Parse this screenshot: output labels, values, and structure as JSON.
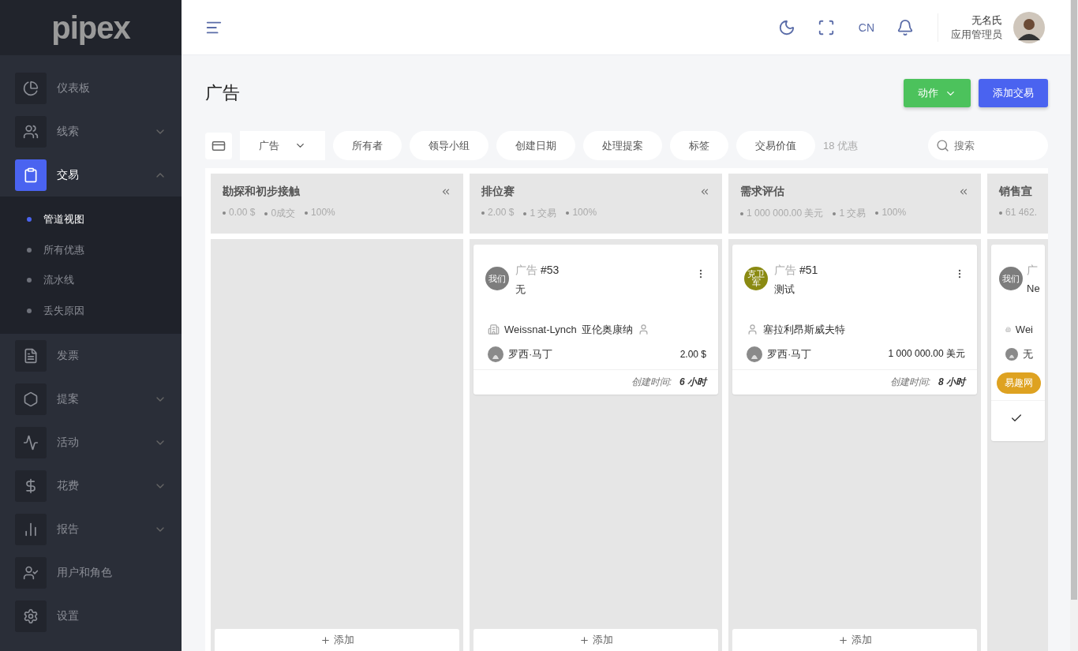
{
  "sidebar": {
    "logo": "pipex",
    "items": [
      {
        "label": "仪表板",
        "selected": false
      },
      {
        "label": "线索",
        "expanded": false,
        "selected": false
      },
      {
        "label": "交易",
        "expanded": true,
        "selected": true,
        "children": [
          {
            "label": "管道视图",
            "selected": true
          },
          {
            "label": "所有优惠",
            "selected": false
          },
          {
            "label": "流水线",
            "selected": false
          },
          {
            "label": "丢失原因",
            "selected": false
          }
        ]
      },
      {
        "label": "发票",
        "selected": false
      },
      {
        "label": "提案",
        "expanded": false,
        "selected": false
      },
      {
        "label": "活动",
        "expanded": false,
        "selected": false
      },
      {
        "label": "花费",
        "expanded": false,
        "selected": false
      },
      {
        "label": "报告",
        "expanded": false,
        "selected": false
      },
      {
        "label": "用户和角色",
        "selected": false
      },
      {
        "label": "设置",
        "selected": false
      }
    ]
  },
  "header": {
    "language": "CN",
    "user": {
      "name": "无名氏",
      "role": "应用管理员"
    }
  },
  "page": {
    "title": "广告",
    "buttons": [
      {
        "label": "动作",
        "kind": "dropdown"
      },
      {
        "label": "添加交易",
        "kind": "primary"
      }
    ]
  },
  "filters": {
    "pipeline": "广告",
    "pills": [
      "所有者",
      "领导小组",
      "创建日期",
      "处理提案",
      "标签",
      "交易价值"
    ],
    "count": "18 优惠",
    "search": {
      "placeholder": "搜索"
    }
  },
  "columns": [
    {
      "title": "勘探和初步接触",
      "stats": [
        "0.00 $",
        "0成交",
        "100%"
      ],
      "add": "添加"
    },
    {
      "title": "排位赛",
      "stats": [
        "2.00 $",
        "1 交易",
        "100%"
      ],
      "cards": [
        {
          "avatar": {
            "text": "我们",
            "color": "#7d7d7d"
          },
          "prefix": "广告",
          "number": "#53",
          "subtitle": "无",
          "company": "Weissnat-Lynch",
          "contact": "亚伦奥康纳",
          "owner": "罗西·马丁",
          "amount": "2.00 $",
          "created_label": "创建时间:",
          "created_value": "6 小时"
        }
      ],
      "add": "添加"
    },
    {
      "title": "需求评估",
      "stats": [
        "1 000 000.00 美元",
        "1 交易",
        "100%"
      ],
      "cards": [
        {
          "avatar": {
            "text": "克卫军",
            "color": "#8a8a12"
          },
          "prefix": "广告",
          "number": "#51",
          "subtitle": "测试",
          "contact": "塞拉利昂斯威夫特",
          "owner": "罗西·马丁",
          "amount": "1 000 000.00 美元",
          "created_label": "创建时间:",
          "created_value": "8 小时"
        }
      ],
      "add": "添加"
    },
    {
      "title": "销售宣",
      "stats": [
        "61 462."
      ],
      "cards": [
        {
          "avatar": {
            "text": "我们",
            "color": "#7d7d7d"
          },
          "prefix": "广",
          "subtitle": "Ne",
          "company": "Wei",
          "owner": "无",
          "tag": {
            "text": "易趣网",
            "color": "#dea221"
          },
          "task_done": true
        }
      ]
    }
  ]
}
